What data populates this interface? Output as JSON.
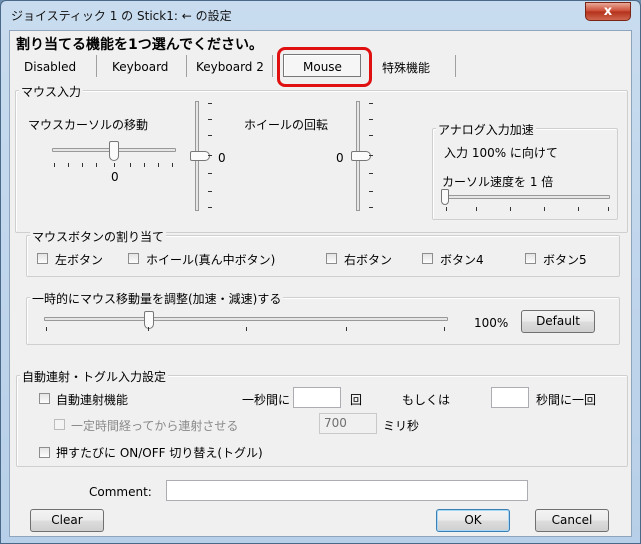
{
  "window": {
    "title": "ジョイスティック 1 の Stick1: ← の設定",
    "close_glyph": "x"
  },
  "header": {
    "instruction": "割り当てる機能を1つ選んでください。"
  },
  "tabs": [
    {
      "label": "Disabled"
    },
    {
      "label": "Keyboard"
    },
    {
      "label": "Keyboard 2"
    },
    {
      "label": "Mouse",
      "selected": true
    },
    {
      "label": "特殊機能"
    }
  ],
  "mouse_input": {
    "legend": "マウス入力",
    "cursor_move_label": "マウスカーソルの移動",
    "cursor_h_value": "0",
    "cursor_v_value": "0",
    "wheel_label": "ホイールの回転",
    "wheel_value": "0",
    "analog": {
      "legend": "アナログ入力加速",
      "line1": "入力 100% に向けて",
      "line2": "カーソル速度を 1 倍"
    }
  },
  "mouse_buttons": {
    "legend": "マウスボタンの割り当て",
    "items": [
      {
        "label": "左ボタン"
      },
      {
        "label": "ホイール(真ん中ボタン)"
      },
      {
        "label": "右ボタン"
      },
      {
        "label": "ボタン4"
      },
      {
        "label": "ボタン5"
      }
    ]
  },
  "temp_adjust": {
    "legend": "一時的にマウス移動量を調整(加速・減速)する",
    "percent_label": "100%",
    "default_button": "Default",
    "slider_fraction": 0.26
  },
  "auto_fire": {
    "legend": "自動連射・トグル入力設定",
    "enable_label": "自動連射機能",
    "per_second_label": "一秒間に",
    "times_label": "回",
    "or_label": "もしくは",
    "once_per_seconds_label": "秒間に一回",
    "per_second_value": "",
    "seconds_value": "",
    "delay_label": "一定時間経ってから連射させる",
    "delay_value": "700",
    "ms_label": "ミリ秒",
    "toggle_label": "押すたびに ON/OFF 切り替え(トグル)"
  },
  "footer": {
    "comment_label": "Comment:",
    "comment_value": "",
    "clear_button": "Clear",
    "ok_button": "OK",
    "cancel_button": "Cancel"
  }
}
